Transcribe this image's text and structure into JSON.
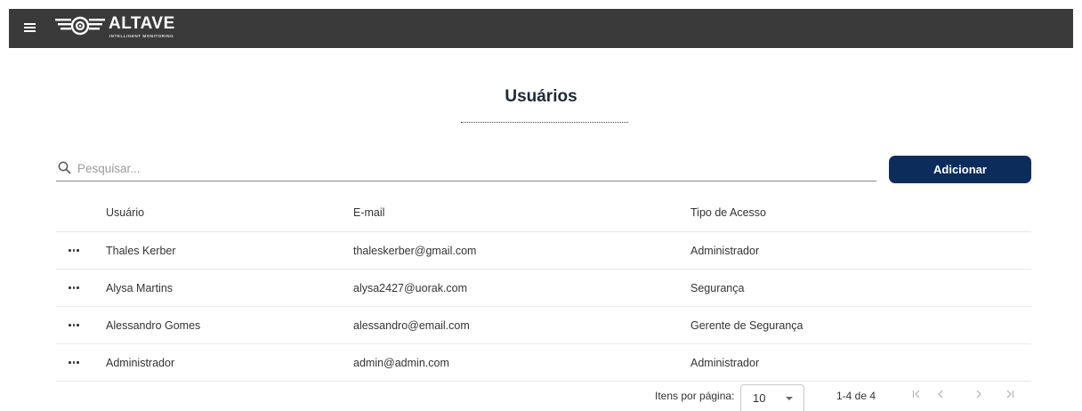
{
  "header": {
    "logo_text": "ALTAVE",
    "logo_subtitle": "INTELLIGENT MONITORING"
  },
  "page": {
    "title": "Usuários"
  },
  "search": {
    "placeholder": "Pesquisar...",
    "value": ""
  },
  "actions": {
    "add_label": "Adicionar"
  },
  "table": {
    "columns": [
      "Usuário",
      "E-mail",
      "Tipo de Acesso"
    ],
    "rows": [
      {
        "user": "Thales Kerber",
        "email": "thaleskerber@gmail.com",
        "access": "Administrador"
      },
      {
        "user": "Alysa Martins",
        "email": "alysa2427@uorak.com",
        "access": "Segurança"
      },
      {
        "user": "Alessandro Gomes",
        "email": "alessandro@email.com",
        "access": "Gerente de Segurança"
      },
      {
        "user": "Administrador",
        "email": "admin@admin.com",
        "access": "Administrador"
      }
    ]
  },
  "paginator": {
    "per_page_label": "Itens por página:",
    "per_page_value": "10",
    "range_label": "1-4 de 4"
  },
  "icons": {
    "menu": "hamburger-menu-icon",
    "search": "magnifier-icon",
    "row_actions": "more-horizontal-icon",
    "first": "first-page-icon",
    "prev": "chevron-left-icon",
    "next": "chevron-right-icon",
    "last": "last-page-icon"
  },
  "colors": {
    "topbar": "#3a3a3a",
    "primary_button": "#0c2c5c"
  }
}
